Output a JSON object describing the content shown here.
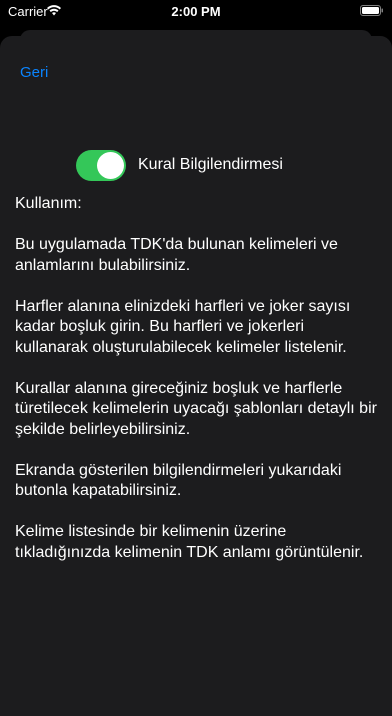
{
  "status_bar": {
    "carrier": "Carrier",
    "time": "2:00 PM"
  },
  "nav": {
    "back_label": "Geri"
  },
  "toggle": {
    "label": "Kural Bilgilendirmesi",
    "on": true,
    "on_color": "#34c759"
  },
  "help": {
    "title": "Kullanım:",
    "paragraphs": [
      "Bu uygulamada TDK'da bulunan kelimeleri ve anlamlarını bulabilirsiniz.",
      "Harfler alanına elinizdeki harfleri ve joker sayısı kadar boşluk girin. Bu harfleri ve jokerleri kullanarak oluşturulabilecek kelimeler listelenir.",
      "Kurallar alanına gireceğiniz boşluk ve harflerle türetilecek kelimelerin uyacağı şablonları detaylı bir şekilde belirleyebilirsiniz.",
      "Ekranda gösterilen bilgilendirmeleri yukarıdaki butonla kapatabilirsiniz.",
      "Kelime listesinde bir kelimenin üzerine tıkladığınızda kelimenin TDK anlamı görüntülenir."
    ]
  },
  "colors": {
    "accent": "#0a84ff",
    "sheet": "#1c1c1e",
    "background": "#000000"
  }
}
